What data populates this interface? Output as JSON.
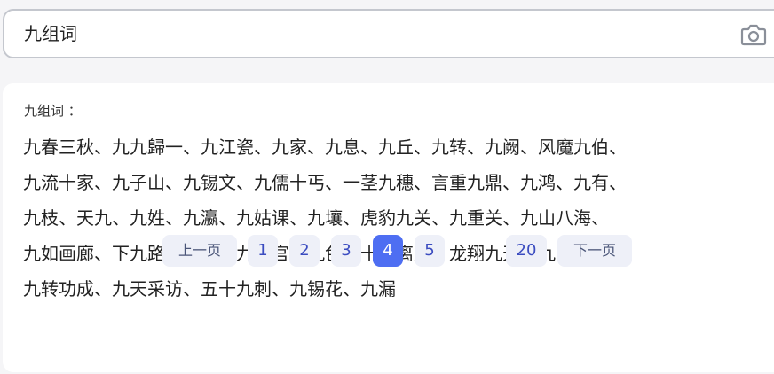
{
  "search": {
    "query": "九组词"
  },
  "card": {
    "title": "九组词 ："
  },
  "words": {
    "lines": [
      "九春三秋、九九歸一、九江瓷、九家、九息、九丘、九转、九阙、风魔九伯、",
      "九流十家、九子山、九锡文、九儒十丐、一茎九穗、言重九鼎、九鸿、九有、",
      "九枝、天九、九姓、九瀛、九姑课、九壤、虎豹九关、九重关、九山八海、",
      "九如画廊、下九路、九大、九参官、九色、十不离九、龙翔九天、九子连环、",
      "九转功成、九天采访、五十九刺、九锡花、九漏"
    ]
  },
  "pagination": {
    "prev": "上一页",
    "next": "下一页",
    "pages": [
      "1",
      "2",
      "3",
      "4",
      "5"
    ],
    "ellipsis": "...",
    "last": "20",
    "current": "4"
  },
  "colors": {
    "accent": "#4e6ef2",
    "pager_bg": "#eef0f8",
    "page_text": "#3b4cc0"
  }
}
